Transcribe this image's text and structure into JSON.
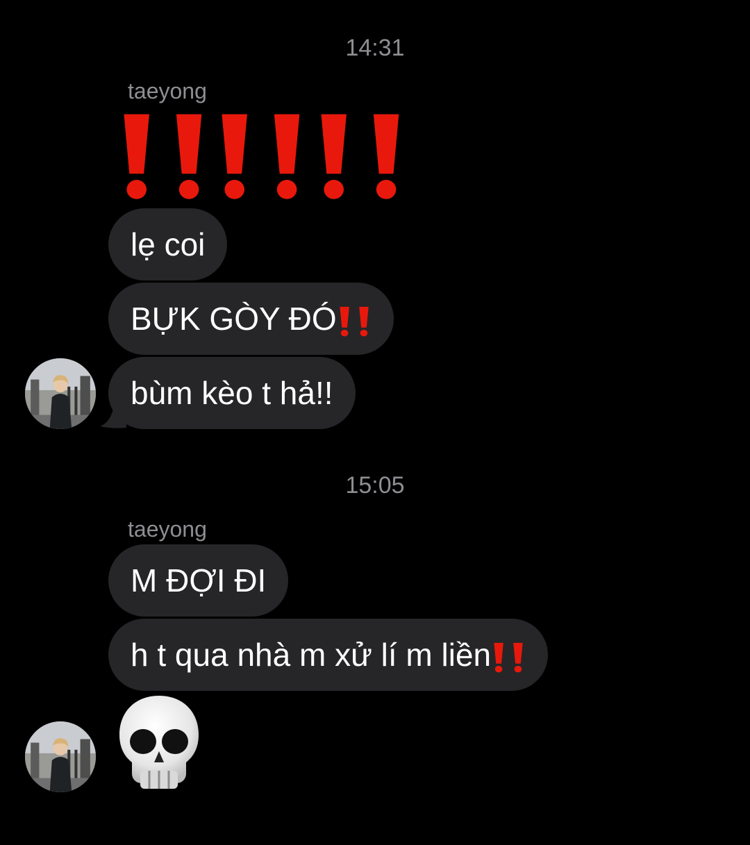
{
  "conversation": {
    "groups": [
      {
        "time": "14:31",
        "sender": "taeyong",
        "messages": [
          {
            "text": "lẹ coi"
          },
          {
            "text": "BỰK GÒY ĐÓ"
          },
          {
            "text": "bùm kèo t hả!!"
          }
        ]
      },
      {
        "time": "15:05",
        "sender": "taeyong",
        "messages": [
          {
            "text": "M ĐỢI ĐI"
          },
          {
            "text": "h t qua nhà m xử lí m liền"
          }
        ]
      }
    ]
  },
  "icons": {
    "big_exclamations": "double-exclamation-emoji",
    "inline_exclamation": "double-exclamation-emoji",
    "skull": "skull-emoji",
    "avatar": "user-avatar"
  },
  "colors": {
    "background": "#000000",
    "bubble": "#262628",
    "meta_text": "#8e8e93",
    "emoji_red": "#e8190c"
  }
}
